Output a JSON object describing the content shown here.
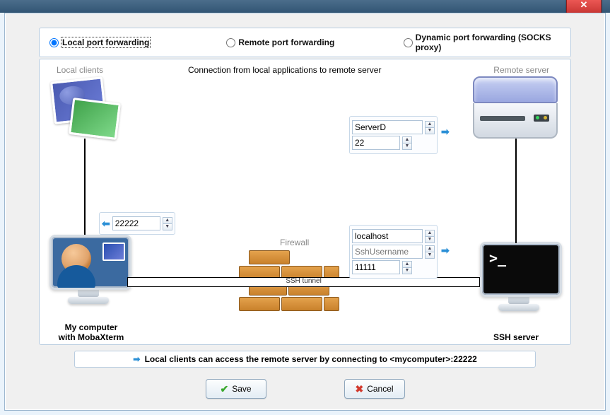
{
  "options": {
    "local": "Local port forwarding",
    "remote": "Remote port forwarding",
    "dynamic": "Dynamic port forwarding (SOCKS proxy)",
    "selected": "local"
  },
  "diagram": {
    "heading": "Connection from local applications to remote server",
    "local_clients_label": "Local clients",
    "remote_server_label": "Remote server",
    "firewall_label": "Firewall",
    "tunnel_label": "SSH tunnel",
    "my_computer_line1": "My computer",
    "my_computer_line2": "with MobaXterm",
    "ssh_server_label": "SSH server"
  },
  "fields": {
    "forwarded_port": "22222",
    "remote_host": "ServerD",
    "remote_port": "22",
    "ssh_host": "localhost",
    "ssh_user_placeholder": "SshUsername",
    "ssh_user": "",
    "ssh_port": "11111"
  },
  "footnote": "Local clients can access the remote server by connecting to <mycomputer>:22222",
  "buttons": {
    "save": "Save",
    "cancel": "Cancel"
  }
}
